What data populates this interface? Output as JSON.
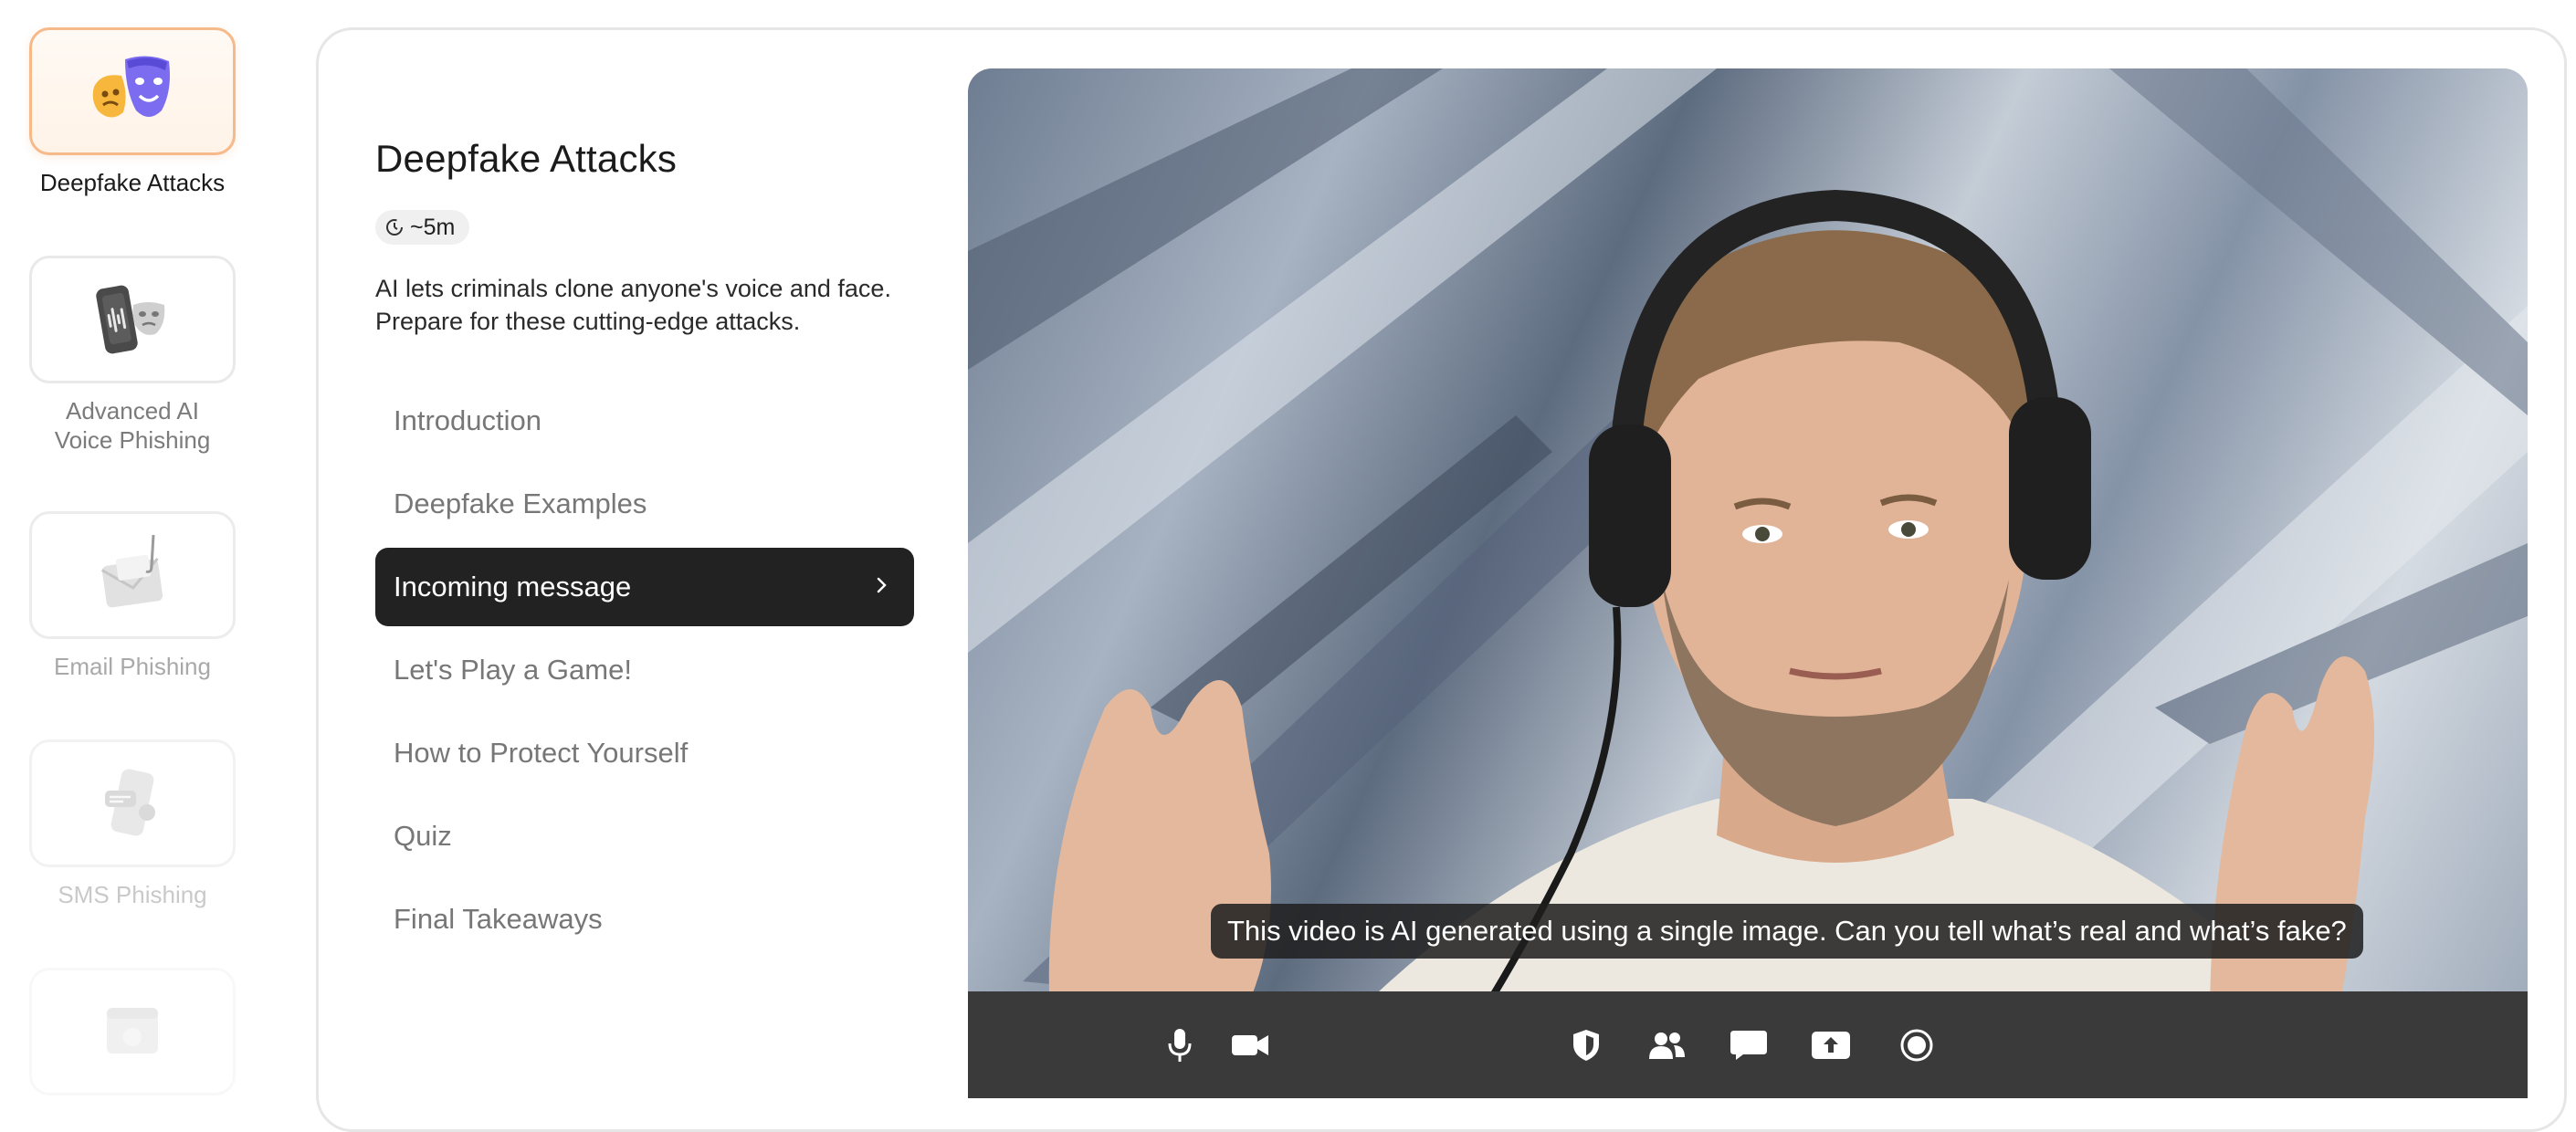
{
  "modules": [
    {
      "label": "Deepfake Attacks",
      "icon": "theater-masks-icon",
      "state": "active"
    },
    {
      "label": "Advanced AI Voice Phishing",
      "icon": "phone-mask-icon",
      "state": "normal"
    },
    {
      "label": "Email Phishing",
      "icon": "envelope-hook-icon",
      "state": "dim"
    },
    {
      "label": "SMS Phishing",
      "icon": "phone-message-icon",
      "state": "dimmer"
    },
    {
      "label": "",
      "icon": "browser-icon",
      "state": "faded"
    }
  ],
  "lesson": {
    "title": "Deepfake Attacks",
    "duration": "~5m",
    "description": "AI lets criminals clone anyone's voice and face. Prepare for these cutting-edge attacks."
  },
  "chapters": [
    {
      "label": "Introduction",
      "active": false
    },
    {
      "label": "Deepfake Examples",
      "active": false
    },
    {
      "label": "Incoming message",
      "active": true
    },
    {
      "label": "Let's Play a Game!",
      "active": false
    },
    {
      "label": "How to Protect Yourself",
      "active": false
    },
    {
      "label": "Quiz",
      "active": false
    },
    {
      "label": "Final Takeaways",
      "active": false
    }
  ],
  "video": {
    "caption": "This video is AI generated using a single image. Can you tell what’s real and what’s fake?",
    "controls": [
      "microphone-icon",
      "camera-icon",
      "shield-icon",
      "participants-icon",
      "chat-icon",
      "share-screen-icon",
      "record-icon"
    ]
  },
  "colors": {
    "active_chapter_bg": "#222222",
    "active_module_border": "#f5b98a",
    "video_toolbar": "#3a3a3a"
  }
}
